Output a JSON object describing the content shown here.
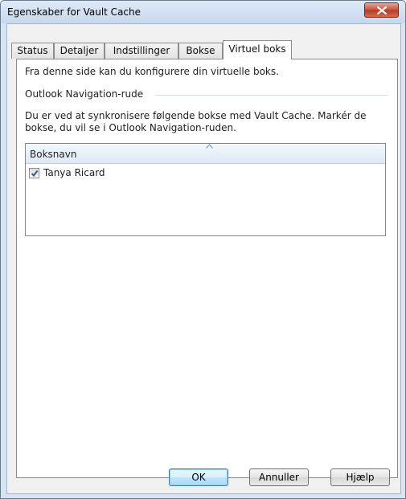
{
  "window": {
    "title": "Egenskaber for Vault Cache",
    "close_icon": "close-x-icon"
  },
  "tabs": [
    {
      "label": "Status"
    },
    {
      "label": "Detaljer"
    },
    {
      "label": "Indstillinger"
    },
    {
      "label": "Bokse"
    },
    {
      "label": "Virtuel boks",
      "active": true
    }
  ],
  "panel": {
    "intro_text": "Fra denne side kan du konfigurere din virtuelle boks.",
    "group_label": "Outlook Navigation-rude",
    "description": "Du er ved at synkronisere følgende bokse med Vault Cache. Markér de bokse, du vil se i Outlook Navigation-ruden.",
    "list": {
      "column_header": "Boksnavn",
      "sort_icon": "sort-ascending-icon",
      "rows": [
        {
          "name": "Tanya Ricard",
          "checked": true
        }
      ]
    }
  },
  "buttons": {
    "ok": "OK",
    "cancel": "Annuller",
    "help": "Hjælp"
  },
  "colors": {
    "window_frame": "#d9e4f1",
    "close_button": "#c8503a",
    "list_header": "#dde9f5",
    "default_button_border": "#3c7fb1"
  }
}
